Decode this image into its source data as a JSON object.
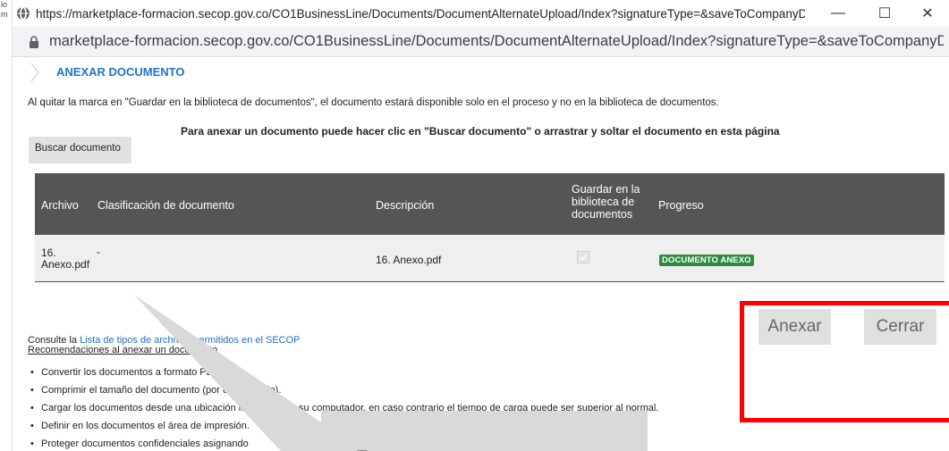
{
  "background_window": {
    "edge_text": [
      "lo",
      "m"
    ]
  },
  "window": {
    "title_url": "https://marketplace-formacion.secop.gov.co/CO1BusinessLine/Documents/DocumentAlternateUpload/Index?signatureType=&saveToCompanyDocs=...",
    "minimize_symbol": "—",
    "maximize_symbol": "☐",
    "close_symbol": "✕",
    "address_url": "marketplace-formacion.secop.gov.co/CO1BusinessLine/Documents/DocumentAlternateUpload/Index?signatureType=&saveToCompanyDocs=Tru..."
  },
  "page": {
    "section_title": "ANEXAR DOCUMENTO",
    "notice": "Al quitar la marca en \"Guardar en la biblioteca de documentos\", el documento estará disponible solo en el proceso y no en la biblioteca de documentos.",
    "instruction": "Para anexar un documento puede hacer clic en \"Buscar documento\" o arrastrar y soltar el documento en esta página",
    "search_button": "Buscar documento"
  },
  "table": {
    "headers": {
      "archivo": "Archivo",
      "clasificacion": "Clasificación de documento",
      "descripcion": "Descripción",
      "guardar": "Guardar en la biblioteca de documentos",
      "progreso": "Progreso"
    },
    "rows": [
      {
        "archivo": "16. Anexo.pdf",
        "clasificacion": "-",
        "descripcion": "16. Anexo.pdf",
        "guardar_checked": true,
        "progreso": "DOCUMENTO ANEXO"
      }
    ]
  },
  "info": {
    "consult_prefix": "Consulte la ",
    "consult_link": "Lista de tipos de archivos permitidos en el SECOP",
    "recommendations_title": "Recomendaciones al anexar un documento",
    "recommendations": [
      "Convertir los documentos a formato PDF.",
      "Comprimir el tamaño del documento (por ejemplo .zip).",
      "Cargar los documentos desde una ubicación localizada en su computador, en caso contrario el tiempo de carga puede ser superior al normal.",
      "Definir en los documentos el área de impresión.",
      "Proteger documentos confidenciales asignando"
    ]
  },
  "actions": {
    "anexar": "Anexar",
    "cerrar": "Cerrar"
  },
  "callout": {
    "text": "T"
  },
  "colors": {
    "link": "#1f73c8",
    "table_header_bg": "#555555",
    "badge_bg": "#2e8b3e",
    "highlight": "#ff0000",
    "callout_bg": "#d9d9d9"
  }
}
